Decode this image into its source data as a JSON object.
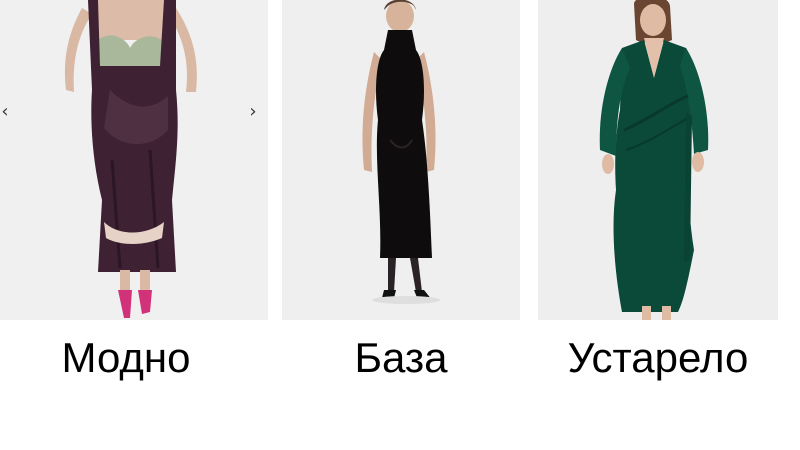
{
  "carousel": {
    "prev_icon": "chevron-left-icon",
    "next_icon": "chevron-right-icon",
    "prev_glyph": "‹",
    "next_glyph": "›"
  },
  "items": [
    {
      "caption": "Модно",
      "photo": "model-in-purple-velvet-dress",
      "dress_color": "#3e2233",
      "background_color": "#f0f0f0"
    },
    {
      "caption": "База",
      "photo": "model-in-black-velvet-dress",
      "dress_color": "#0f0c0e",
      "background_color": "#efefef"
    },
    {
      "caption": "Устарело",
      "photo": "model-in-green-velvet-wrap-dress",
      "dress_color": "#0b4a38",
      "background_color": "#eeeeee"
    }
  ]
}
